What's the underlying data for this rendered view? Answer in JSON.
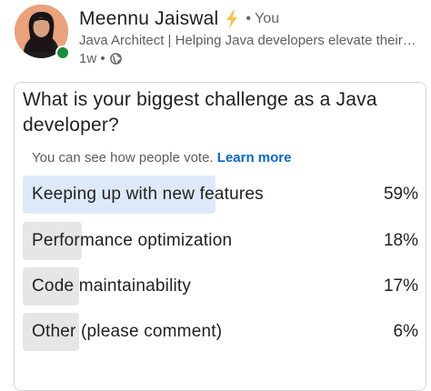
{
  "author": {
    "name": "Meennu Jaiswal",
    "connection": "• You",
    "headline": "Java Architect | Helping Java developers elevate their ...",
    "time": "1w •",
    "online": true
  },
  "poll": {
    "question": "What is your biggest challenge as a Java developer?",
    "visibility_text": "You can see how people vote.",
    "learn_more": "Learn more",
    "options": [
      {
        "label": "Keeping up with new features",
        "percent": "59%",
        "value": 59,
        "selected": true
      },
      {
        "label": "Performance optimization",
        "percent": "18%",
        "value": 18,
        "selected": false
      },
      {
        "label": "Code maintainability",
        "percent": "17%",
        "value": 17,
        "selected": false
      },
      {
        "label": "Other (please comment)",
        "percent": "6%",
        "value": 6,
        "selected": false
      }
    ]
  },
  "colors": {
    "accent": "#0a66c2",
    "selected_fill": "#dde9f8",
    "fill": "#e6e6e6",
    "online": "#1a8a3c",
    "bolt": "#f5c451"
  },
  "icons": {
    "bolt": "lightning-bolt-icon",
    "globe": "globe-icon"
  }
}
